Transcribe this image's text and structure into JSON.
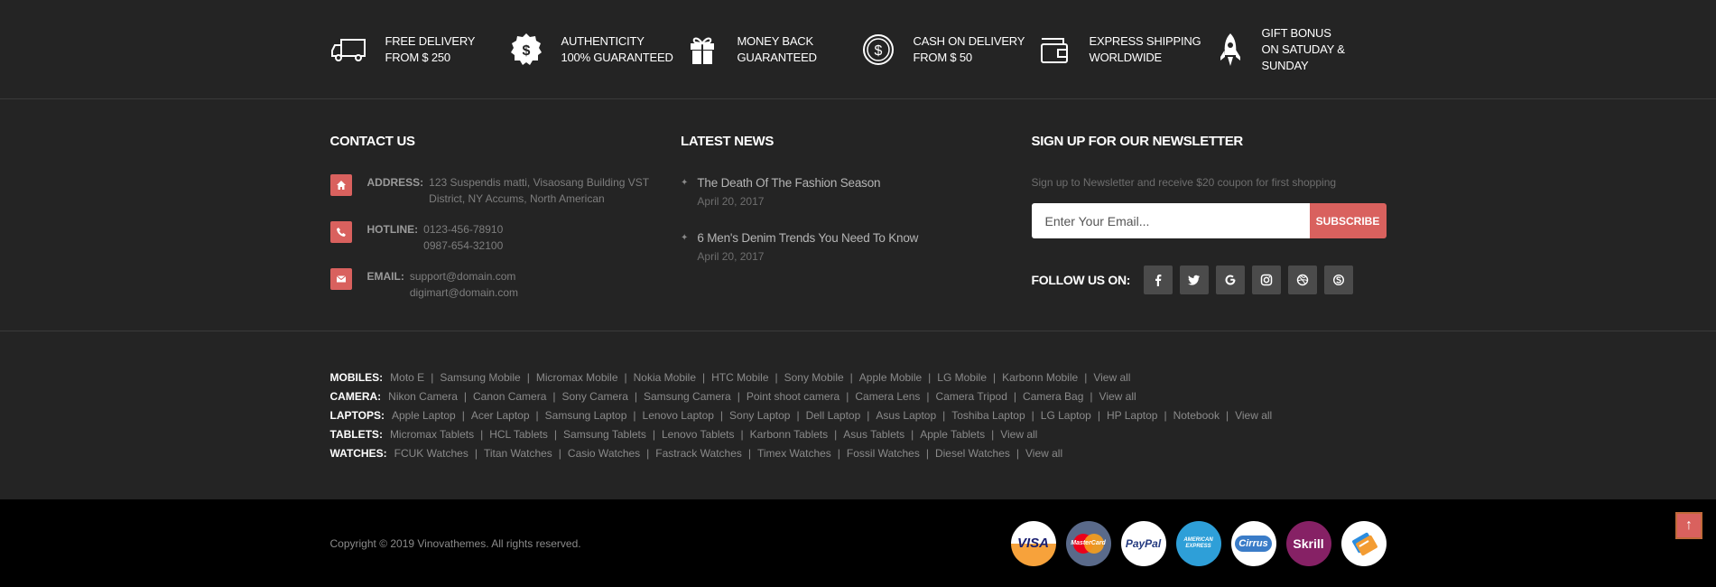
{
  "features": [
    {
      "icon": "truck-icon",
      "line1": "FREE DELIVERY",
      "line2": "FROM $ 250"
    },
    {
      "icon": "dollar-badge-icon",
      "line1": "AUTHENTICITY",
      "line2": "100% GUARANTEED"
    },
    {
      "icon": "gift-icon",
      "line1": "MONEY BACK",
      "line2": "GUARANTEED"
    },
    {
      "icon": "dollar-circle-icon",
      "line1": "CASH ON DELIVERY",
      "line2": "FROM $ 50"
    },
    {
      "icon": "wallet-icon",
      "line1": "EXPRESS SHIPPING",
      "line2": "WORLDWIDE"
    },
    {
      "icon": "rocket-icon",
      "line1": "GIFT BONUS",
      "line2": "ON SATUDAY & SUNDAY"
    }
  ],
  "contact": {
    "heading": "CONTACT US",
    "address_label": "ADDRESS:",
    "address_line1": "123 Suspendis matti, Visaosang Building VST",
    "address_line2": "District, NY Accums, North American",
    "hotline_label": "HOTLINE:",
    "hotline_line1": "0123-456-78910",
    "hotline_line2": "0987-654-32100",
    "email_label": "EMAIL:",
    "email_line1": "support@domain.com",
    "email_line2": "digimart@domain.com"
  },
  "news": {
    "heading": "LATEST NEWS",
    "items": [
      {
        "title": "The Death Of The Fashion Season",
        "date": "April 20, 2017"
      },
      {
        "title": "6 Men's Denim Trends You Need To Know",
        "date": "April 20, 2017"
      }
    ]
  },
  "newsletter": {
    "heading": "SIGN UP FOR OUR NEWSLETTER",
    "description": "Sign up to Newsletter and receive $20 coupon for first shopping",
    "placeholder": "Enter Your Email...",
    "button": "SUBSCRIBE",
    "follow_label": "FOLLOW US ON:",
    "social": [
      "facebook-icon",
      "twitter-icon",
      "google-icon",
      "instagram-icon",
      "dribbble-icon",
      "skype-icon"
    ]
  },
  "link_rows": [
    {
      "category": "MOBILES:",
      "items": [
        "Moto E",
        "Samsung Mobile",
        "Micromax Mobile",
        "Nokia Mobile",
        "HTC Mobile",
        "Sony Mobile",
        "Apple Mobile",
        "LG Mobile",
        "Karbonn Mobile",
        "View all"
      ]
    },
    {
      "category": "CAMERA:",
      "items": [
        "Nikon Camera",
        "Canon Camera",
        "Sony Camera",
        "Samsung Camera",
        "Point shoot camera",
        "Camera Lens",
        "Camera Tripod",
        "Camera Bag",
        "View all"
      ]
    },
    {
      "category": "LAPTOPS:",
      "items": [
        "Apple Laptop",
        "Acer Laptop",
        "Samsung Laptop",
        "Lenovo Laptop",
        "Sony Laptop",
        "Dell Laptop",
        "Asus Laptop",
        "Toshiba Laptop",
        "LG Laptop",
        "HP Laptop",
        "Notebook",
        "View all"
      ]
    },
    {
      "category": "TABLETS:",
      "items": [
        "Micromax Tablets",
        "HCL Tablets",
        "Samsung Tablets",
        "Lenovo Tablets",
        "Karbonn Tablets",
        "Asus Tablets",
        "Apple Tablets",
        "View all"
      ]
    },
    {
      "category": "WATCHES:",
      "items": [
        "FCUK Watches",
        "Titan Watches",
        "Casio Watches",
        "Fastrack Watches",
        "Timex Watches",
        "Fossil Watches",
        "Diesel Watches",
        "View all"
      ]
    }
  ],
  "copyright": "Copyright © 2019 Vinovathemes. All rights reserved.",
  "payments": [
    {
      "name": "VISA",
      "color": "#1a1f71"
    },
    {
      "name": "MasterCard",
      "color": "#5a6a8a"
    },
    {
      "name": "PayPal",
      "color": "#ffffff"
    },
    {
      "name": "AMERICAN EXPRESS",
      "color": "#2e9fd8"
    },
    {
      "name": "Cirrus",
      "color": "#ffffff"
    },
    {
      "name": "Skrill",
      "color": "#862165"
    },
    {
      "name": "",
      "color": "#ffffff"
    }
  ],
  "accent_color": "#d9615e"
}
